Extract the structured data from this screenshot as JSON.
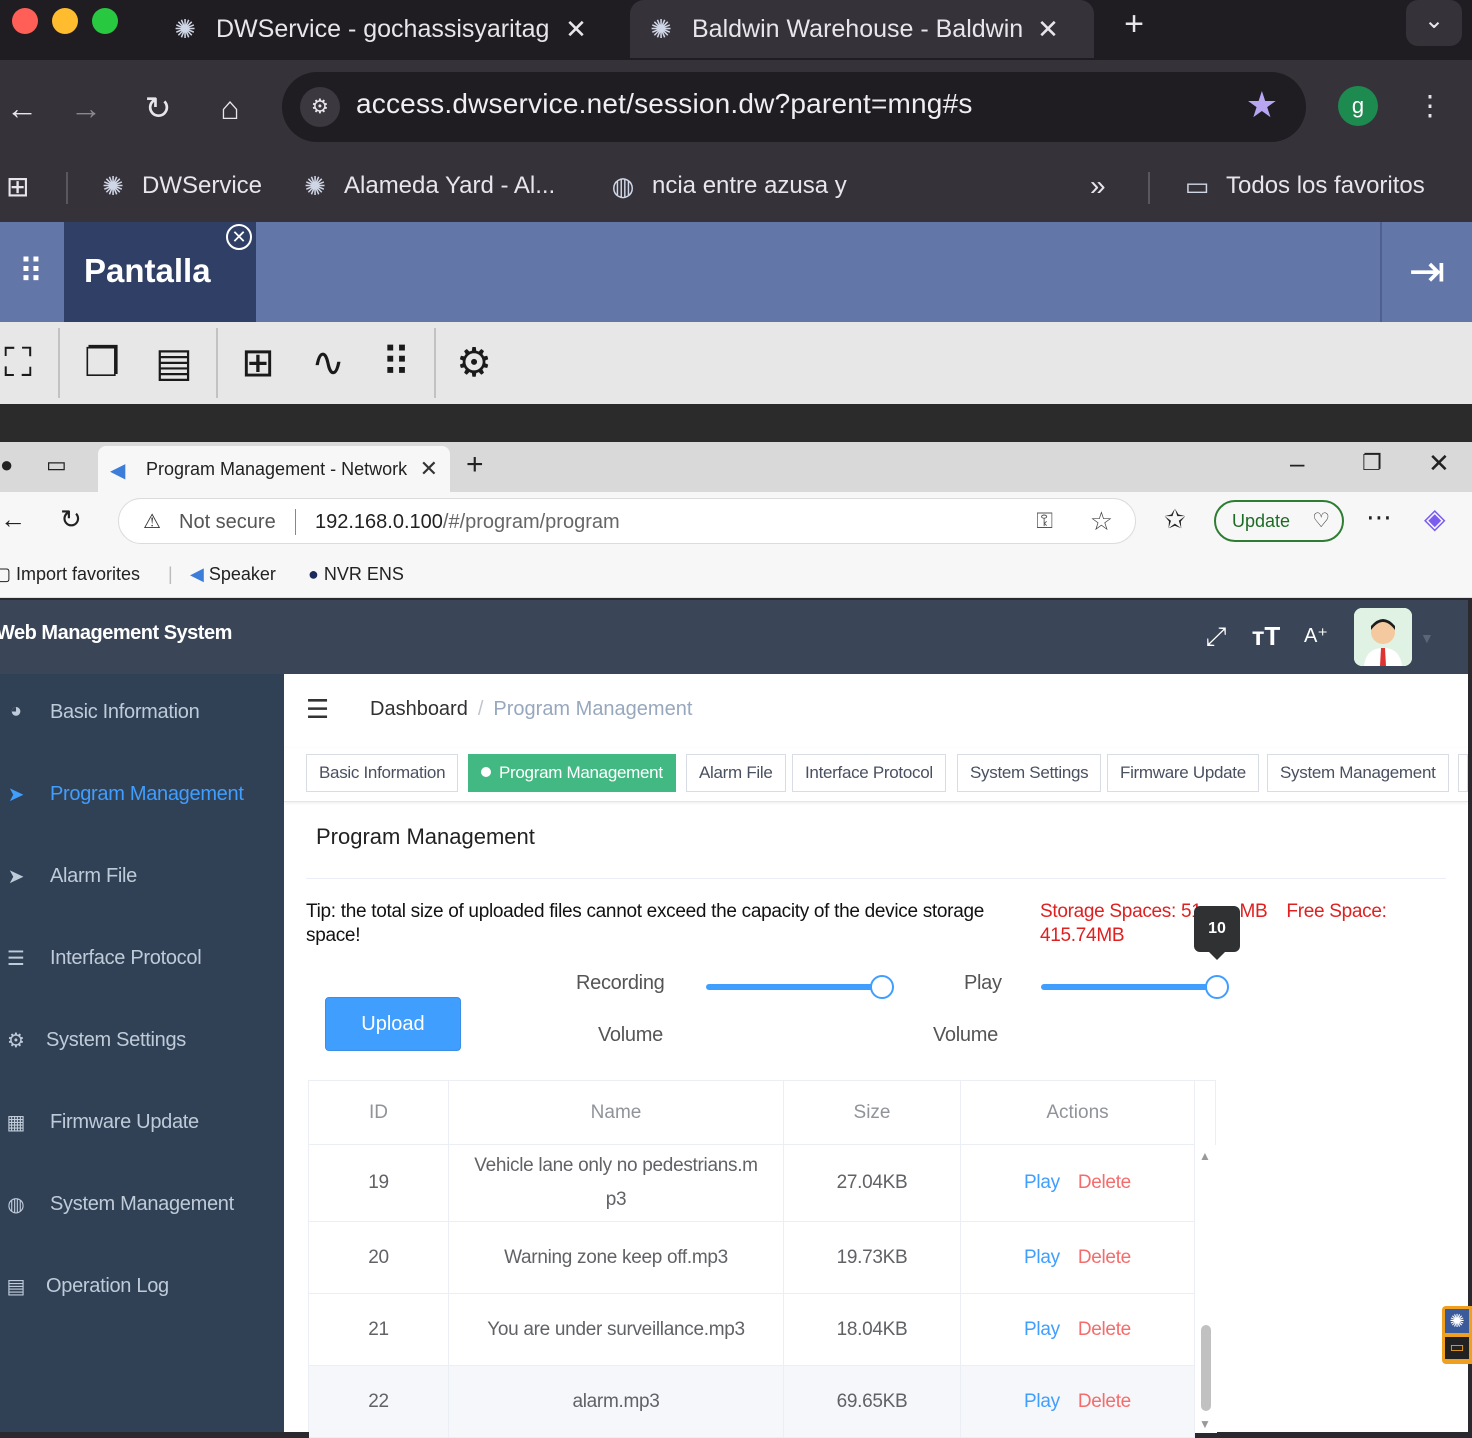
{
  "outer_browser": {
    "tabs": [
      {
        "title": "DWService - gochassisyaritag",
        "close": "✕"
      },
      {
        "title": "Baldwin Warehouse - Baldwin",
        "close": "✕"
      }
    ],
    "new_tab": "+",
    "tab_search": "⌄",
    "url": "access.dwservice.net/session.dw?parent=mng#s",
    "profile_initial": "g",
    "bookmarks": [
      {
        "label": "DWService"
      },
      {
        "label": "Alameda Yard - Al..."
      },
      {
        "label": "ncia entre azusa y"
      }
    ],
    "overflow": "»",
    "all_bookmarks": "Todos los favoritos"
  },
  "dwservice": {
    "tab_label": "Pantalla",
    "close_glyph": "✕"
  },
  "inner_browser": {
    "tab_title": "Program Management - Network",
    "not_secure": "Not secure",
    "url_host": "192.168.0.100",
    "url_path": "/#/program/program",
    "update_label": "Update",
    "bookmarks": [
      "Import favorites",
      "Speaker",
      "NVR ENS"
    ]
  },
  "app": {
    "title": "Web Management System",
    "sidebar": [
      {
        "label": "Basic Information",
        "icon": "dashboard-icon"
      },
      {
        "label": "Program Management",
        "icon": "send-icon"
      },
      {
        "label": "Alarm File",
        "icon": "send-icon"
      },
      {
        "label": "Interface Protocol",
        "icon": "document-icon"
      },
      {
        "label": "System Settings",
        "icon": "gear-icon"
      },
      {
        "label": "Firmware Update",
        "icon": "grid-icon"
      },
      {
        "label": "System Management",
        "icon": "globe-icon"
      },
      {
        "label": "Operation Log",
        "icon": "log-icon"
      }
    ],
    "breadcrumb": {
      "root": "Dashboard",
      "separator": "/",
      "current": "Program Management"
    },
    "tags": [
      "Basic Information",
      "Program Management",
      "Alarm File",
      "Interface Protocol",
      "System Settings",
      "Firmware Update",
      "System Management"
    ],
    "active_tag": "Program Management",
    "page_title": "Program Management",
    "tip": "Tip: the total size of uploaded files cannot exceed the capacity of the device storage space!",
    "storage_label": "Storage Spaces: 51",
    "storage_tail": "MB",
    "free_label": "Free Space:",
    "free_value": "415.74MB",
    "tooltip_value": "10",
    "recording_label_1": "Recording",
    "recording_label_2": "Volume",
    "play_label_1": "Play",
    "play_label_2": "Volume",
    "recording_volume_fraction": 1.0,
    "play_volume_fraction": 1.0,
    "upload_label": "Upload",
    "table": {
      "headers": [
        "ID",
        "Name",
        "Size",
        "Actions"
      ],
      "rows": [
        {
          "id": "19",
          "name": "Vehicle lane only no pedestrians.m p3",
          "size": "27.04KB",
          "play": "Play",
          "delete": "Delete"
        },
        {
          "id": "20",
          "name": "Warning zone keep off.mp3",
          "size": "19.73KB",
          "play": "Play",
          "delete": "Delete"
        },
        {
          "id": "21",
          "name": "You are under surveillance.mp3",
          "size": "18.04KB",
          "play": "Play",
          "delete": "Delete"
        },
        {
          "id": "22",
          "name": "alarm.mp3",
          "size": "69.65KB",
          "play": "Play",
          "delete": "Delete"
        }
      ]
    }
  },
  "colors": {
    "accent_blue": "#409eff",
    "active_tag_green": "#42b983",
    "danger_red": "#f56c6c",
    "sidebar_bg": "#304156",
    "dw_bar": "#6276a8"
  }
}
